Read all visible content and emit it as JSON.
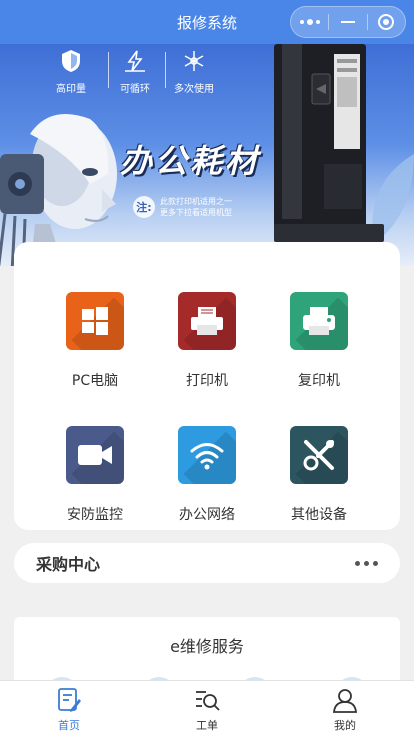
{
  "nav": {
    "title": "报修系统",
    "capsule_icons": [
      "more-dots-icon",
      "minimize-icon",
      "close-target-icon"
    ]
  },
  "banner": {
    "features": [
      {
        "label": "高印量",
        "icon": "shield-icon"
      },
      {
        "label": "可循环",
        "icon": "bolt-icon"
      },
      {
        "label": "多次使用",
        "icon": "snowflake-icon"
      }
    ],
    "headline": "办公耗材",
    "note_mark": "注:",
    "note_line1": "此款打印机适用之一",
    "note_line2": "更多下拉看适用机型"
  },
  "categories": [
    {
      "label": "PC电脑",
      "icon": "windows-icon",
      "color": "#e8621a"
    },
    {
      "label": "打印机",
      "icon": "printer-icon",
      "color": "#a52a2a"
    },
    {
      "label": "复印机",
      "icon": "copier-icon",
      "color": "#2fa37a"
    },
    {
      "label": "安防监控",
      "icon": "camera-icon",
      "color": "#4a5a8a"
    },
    {
      "label": "办公网络",
      "icon": "wifi-icon",
      "color": "#2e9be0"
    },
    {
      "label": "其他设备",
      "icon": "tools-icon",
      "color": "#2d5560"
    }
  ],
  "purchase": {
    "title": "采购中心",
    "more_icon": "more-dots-icon"
  },
  "service": {
    "title": "e维修服务"
  },
  "tabbar": {
    "items": [
      {
        "label": "首页",
        "icon": "home-doc-icon",
        "active": true
      },
      {
        "label": "工单",
        "icon": "search-list-icon",
        "active": false
      },
      {
        "label": "我的",
        "icon": "user-icon",
        "active": false
      }
    ],
    "active_color": "#3a7bd5"
  }
}
